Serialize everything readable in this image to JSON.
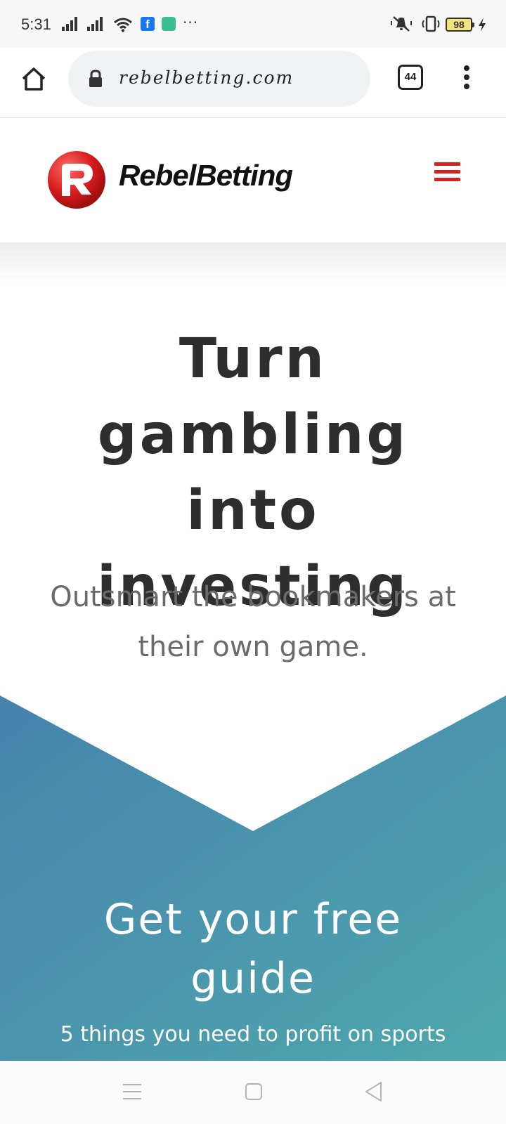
{
  "status_bar": {
    "time": "5:31",
    "battery_level": "98",
    "notification_more": "···"
  },
  "browser": {
    "url": "rebelbetting.com",
    "tab_count": "44"
  },
  "site": {
    "brand_name": "RebelBetting",
    "brand_color": "#d42222"
  },
  "hero": {
    "title_lines": [
      "Turn",
      "gambling into",
      "investing"
    ],
    "subtitle_lines": [
      "Outsmart the bookmakers at",
      "their own game."
    ]
  },
  "guide": {
    "title_lines": [
      "Get your free",
      "guide"
    ],
    "subtitle": "5 things you need to profit on sports",
    "gradient_start": "#4682ad",
    "gradient_end": "#4ea8ad"
  }
}
